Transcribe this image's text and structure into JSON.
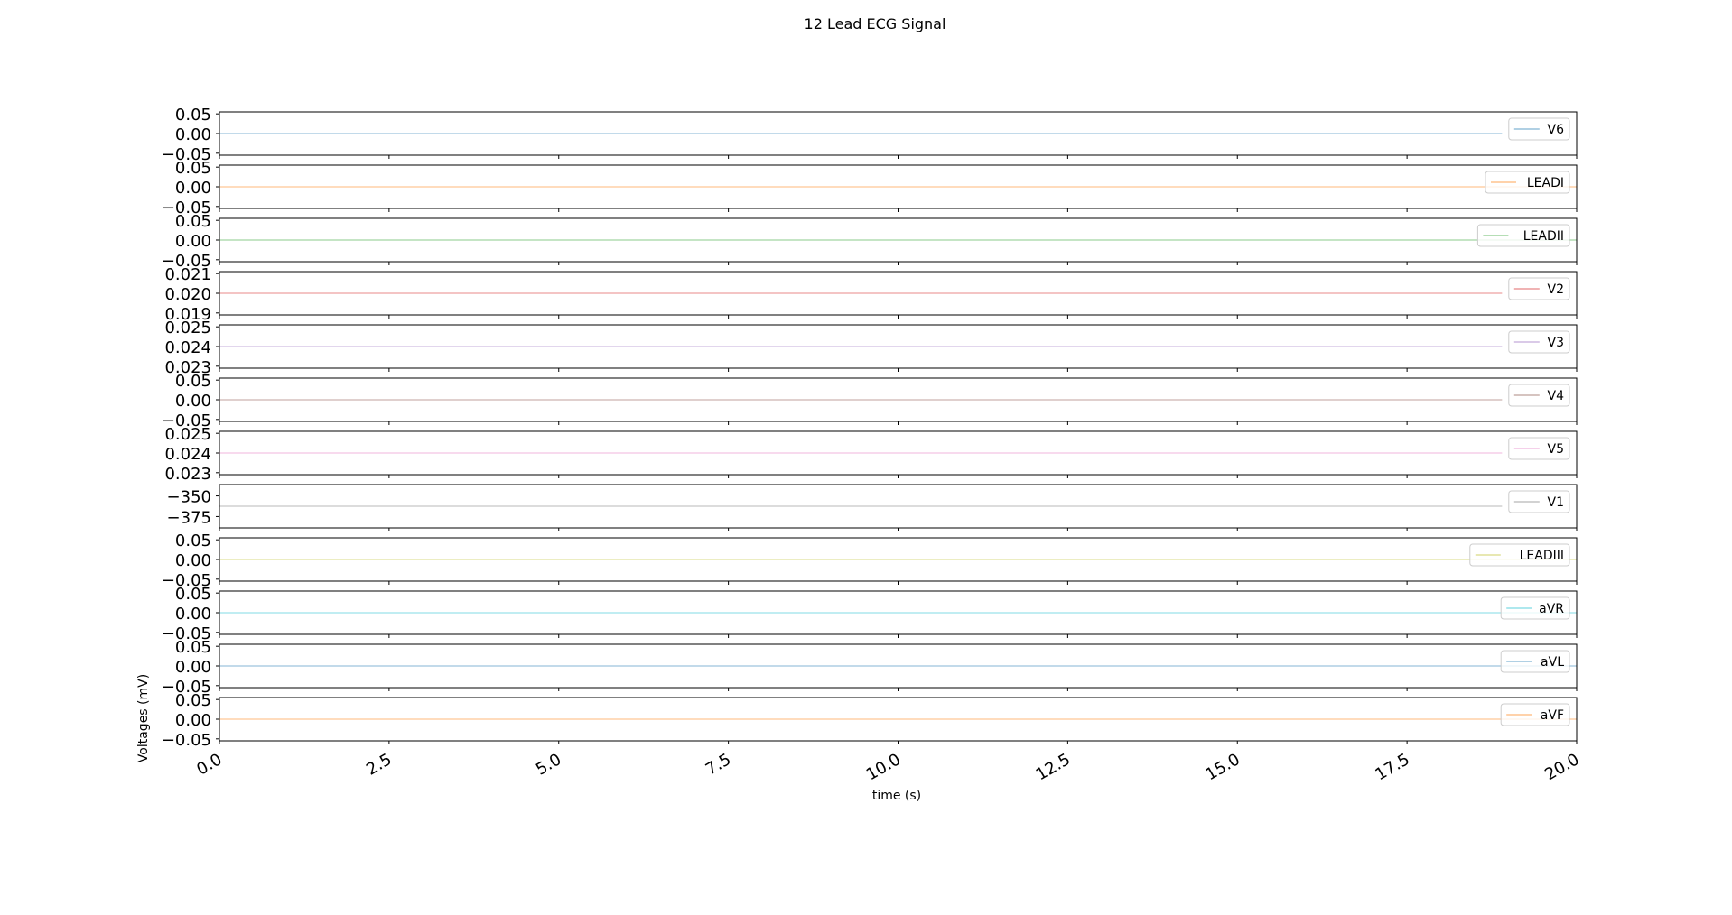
{
  "chart_data": {
    "type": "line",
    "title": "12 Lead ECG Signal",
    "xlabel": "time (s)",
    "ylabel": "Voltages (mV)",
    "xlim": [
      0,
      20
    ],
    "x_ticks": [
      "0.0",
      "2.5",
      "5.0",
      "7.5",
      "10.0",
      "12.5",
      "15.0",
      "17.5",
      "20.0"
    ],
    "x_tick_values": [
      0,
      2.5,
      5,
      7.5,
      10,
      12.5,
      15,
      17.5,
      20
    ],
    "grid": false,
    "legend_position": "right",
    "series": [
      {
        "name": "V6",
        "color": "#1f77b4",
        "x": [
          0,
          18.9
        ],
        "y": [
          0,
          0
        ],
        "ylim": [
          -0.055,
          0.055
        ],
        "yticks": [
          "0.05",
          "0.00",
          "−0.05"
        ],
        "ytick_values": [
          0.05,
          0,
          -0.05
        ]
      },
      {
        "name": "LEADI",
        "color": "#ff7f0e",
        "x": [
          0,
          20
        ],
        "y": [
          0,
          0
        ],
        "ylim": [
          -0.055,
          0.055
        ],
        "yticks": [
          "0.05",
          "0.00",
          "−0.05"
        ],
        "ytick_values": [
          0.05,
          0,
          -0.05
        ]
      },
      {
        "name": "LEADII",
        "color": "#2ca02c",
        "x": [
          0,
          20
        ],
        "y": [
          0,
          0
        ],
        "ylim": [
          -0.055,
          0.055
        ],
        "yticks": [
          "0.05",
          "0.00",
          "−0.05"
        ],
        "ytick_values": [
          0.05,
          0,
          -0.05
        ]
      },
      {
        "name": "V2",
        "color": "#d62728",
        "x": [
          0,
          18.9
        ],
        "y": [
          0.02,
          0.02
        ],
        "ylim": [
          0.0189,
          0.0211
        ],
        "yticks": [
          "0.021",
          "0.020",
          "0.019"
        ],
        "ytick_values": [
          0.021,
          0.02,
          0.019
        ]
      },
      {
        "name": "V3",
        "color": "#9467bd",
        "x": [
          0,
          18.9
        ],
        "y": [
          0.024,
          0.024
        ],
        "ylim": [
          0.0229,
          0.0251
        ],
        "yticks": [
          "0.025",
          "0.024",
          "0.023"
        ],
        "ytick_values": [
          0.025,
          0.024,
          0.023
        ]
      },
      {
        "name": "V4",
        "color": "#8c564b",
        "x": [
          0,
          18.9
        ],
        "y": [
          0,
          0
        ],
        "ylim": [
          -0.055,
          0.055
        ],
        "yticks": [
          "0.05",
          "0.00",
          "−0.05"
        ],
        "ytick_values": [
          0.05,
          0,
          -0.05
        ]
      },
      {
        "name": "V5",
        "color": "#e377c2",
        "x": [
          0,
          18.9
        ],
        "y": [
          0.024,
          0.024
        ],
        "ylim": [
          0.0229,
          0.0251
        ],
        "yticks": [
          "0.025",
          "0.024",
          "0.023"
        ],
        "ytick_values": [
          0.025,
          0.024,
          0.023
        ]
      },
      {
        "name": "V1",
        "color": "#7f7f7f",
        "x": [
          0,
          18.9
        ],
        "y": [
          -362.5,
          -362.5
        ],
        "ylim": [
          -388.75,
          -336.25
        ],
        "yticks": [
          "−350",
          "−375"
        ],
        "ytick_values": [
          -350,
          -375
        ]
      },
      {
        "name": "LEADIII",
        "color": "#bcbd22",
        "x": [
          0,
          20
        ],
        "y": [
          0,
          0
        ],
        "ylim": [
          -0.055,
          0.055
        ],
        "yticks": [
          "0.05",
          "0.00",
          "−0.05"
        ],
        "ytick_values": [
          0.05,
          0,
          -0.05
        ]
      },
      {
        "name": "aVR",
        "color": "#17becf",
        "x": [
          0,
          20
        ],
        "y": [
          0,
          0
        ],
        "ylim": [
          -0.055,
          0.055
        ],
        "yticks": [
          "0.05",
          "0.00",
          "−0.05"
        ],
        "ytick_values": [
          0.05,
          0,
          -0.05
        ]
      },
      {
        "name": "aVL",
        "color": "#1f77b4",
        "x": [
          0,
          20
        ],
        "y": [
          0,
          0
        ],
        "ylim": [
          -0.055,
          0.055
        ],
        "yticks": [
          "0.05",
          "0.00",
          "−0.05"
        ],
        "ytick_values": [
          0.05,
          0,
          -0.05
        ]
      },
      {
        "name": "aVF",
        "color": "#ff7f0e",
        "x": [
          0,
          20
        ],
        "y": [
          0,
          0
        ],
        "ylim": [
          -0.055,
          0.055
        ],
        "yticks": [
          "0.05",
          "0.00",
          "−0.05"
        ],
        "ytick_values": [
          0.05,
          0,
          -0.05
        ]
      }
    ]
  }
}
